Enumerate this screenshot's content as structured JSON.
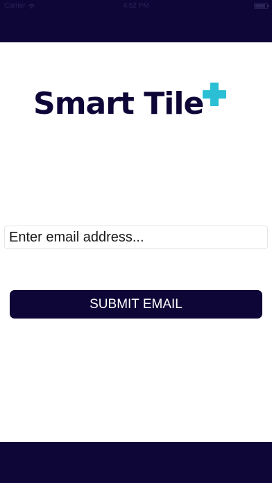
{
  "status_bar": {
    "carrier": "Carrier",
    "time": "4:52 PM",
    "wifi_icon": "wifi-icon",
    "battery_icon": "battery-icon"
  },
  "logo": {
    "text": "Smart Tile",
    "plus_icon": "plus-icon",
    "plus_color": "#2bbfd6"
  },
  "form": {
    "email_placeholder": "Enter email address...",
    "email_value": "",
    "submit_label": "SUBMIT EMAIL"
  },
  "colors": {
    "brand_navy": "#0d0637",
    "brand_cyan": "#2bbfd6"
  }
}
